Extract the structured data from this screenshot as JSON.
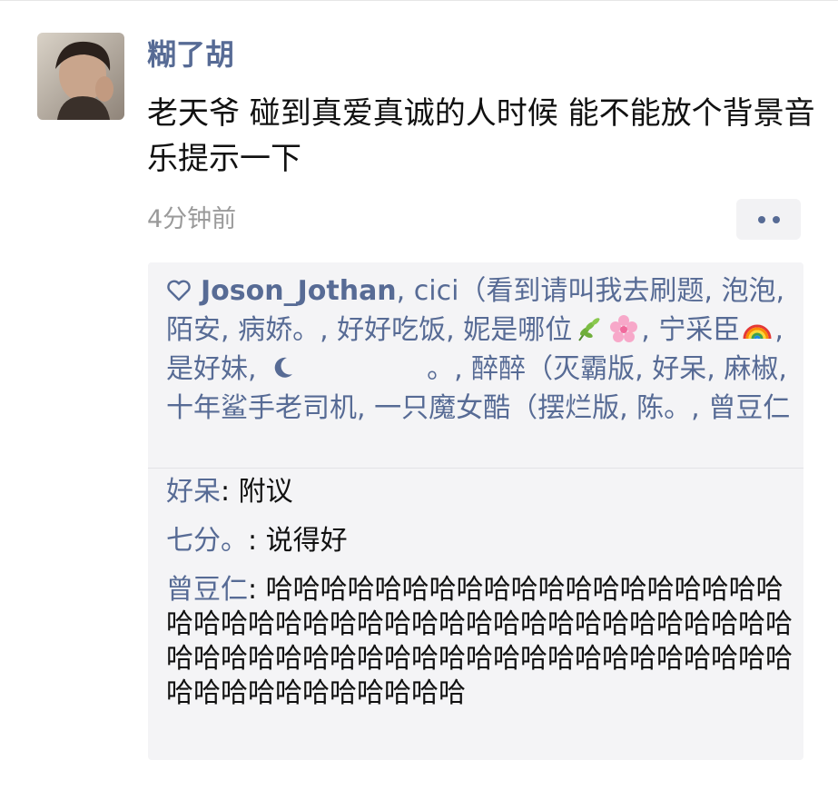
{
  "post": {
    "username": "糊了胡",
    "text": "老天爷 碰到真爱真诚的人时候 能不能放个背景音乐提示一下",
    "timestamp": "4分钟前"
  },
  "icons": {
    "heart": "heart-outline-icon",
    "more": "more-dots-icon"
  },
  "likes": {
    "names": [
      "Joson_Jothan",
      "cici（看到请叫我去刷题",
      "泡泡",
      "陌安",
      "病娇。",
      "好好吃饭",
      "妮是哪位",
      "宁采臣",
      "是好妹",
      "",
      "醉醉（灭霸版",
      "好呆",
      "麻椒",
      "十年鲨手老司机",
      "一只魔女酷（摆烂版",
      "陈。",
      "曾豆仁"
    ],
    "separator": ", ",
    "trailing_dot": "。"
  },
  "comments": [
    {
      "name": "好呆",
      "sep": ": ",
      "text": "附议"
    },
    {
      "name": "七分。",
      "sep": ": ",
      "text": "说得好"
    },
    {
      "name": "曾豆仁",
      "sep": ": ",
      "text": "哈哈哈哈哈哈哈哈哈哈哈哈哈哈哈哈哈哈哈哈哈哈哈哈哈哈哈哈哈哈哈哈哈哈哈哈哈哈哈哈哈哈哈哈哈哈哈哈哈哈哈哈哈哈哈哈哈哈哈哈哈哈哈哈哈哈哈哈哈哈哈哈哈哈哈哈"
    }
  ],
  "colors": {
    "link": "#576b95",
    "text": "#111111",
    "meta": "#9a9a9a",
    "box_bg": "#f4f4f6"
  }
}
